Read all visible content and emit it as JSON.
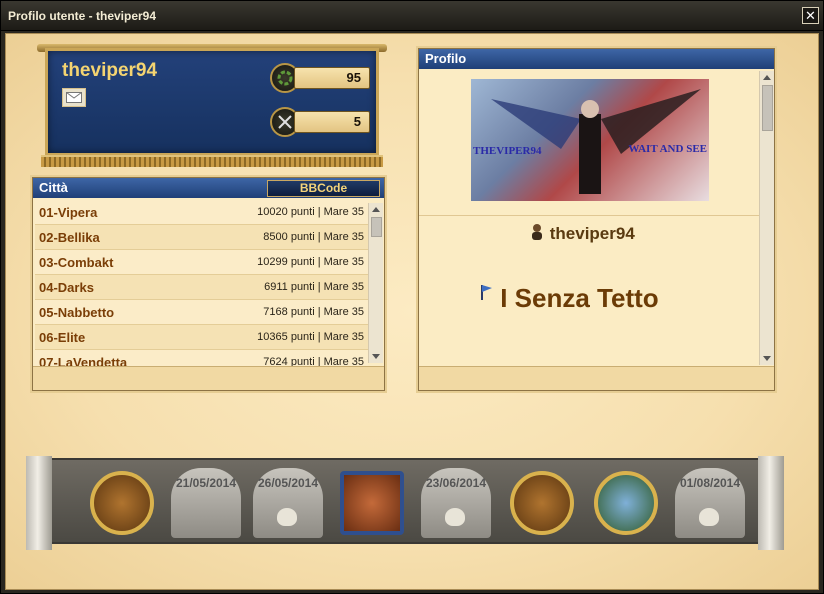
{
  "window": {
    "title": "Profilo utente - theviper94",
    "close_label": "✕"
  },
  "player": {
    "name": "theviper94",
    "stats": [
      {
        "icon": "laurel-icon",
        "value": "95"
      },
      {
        "icon": "crossed-swords-icon",
        "value": "5"
      }
    ]
  },
  "cities_panel": {
    "title": "Città",
    "bbcode_label": "BBCode",
    "rows": [
      {
        "name": "01-Vipera",
        "info": "10020 punti | Mare 35"
      },
      {
        "name": "02-Bellika",
        "info": "8500 punti | Mare 35"
      },
      {
        "name": "03-Combakt",
        "info": "10299 punti | Mare 35"
      },
      {
        "name": "04-Darks",
        "info": "6911 punti | Mare 35"
      },
      {
        "name": "05-Nabbetto",
        "info": "7168 punti | Mare 35"
      },
      {
        "name": "06-Elite",
        "info": "10365 punti | Mare 35"
      },
      {
        "name": "07-LaVendetta",
        "info": "7624 punti | Mare 35"
      }
    ]
  },
  "profile_panel": {
    "title": "Profilo",
    "image_text_left": "THEVIPER94",
    "image_text_right": "WAIT AND SEE",
    "username": "theviper94",
    "alliance": "I Senza Tetto"
  },
  "awards": {
    "tomb_dates": [
      "21/05/2014",
      "26/05/2014",
      "23/06/2014",
      "01/08/2014"
    ]
  },
  "colors": {
    "accent_blue": "#1f3f77",
    "gold": "#f4d471",
    "parchment": "#fbecc4"
  }
}
